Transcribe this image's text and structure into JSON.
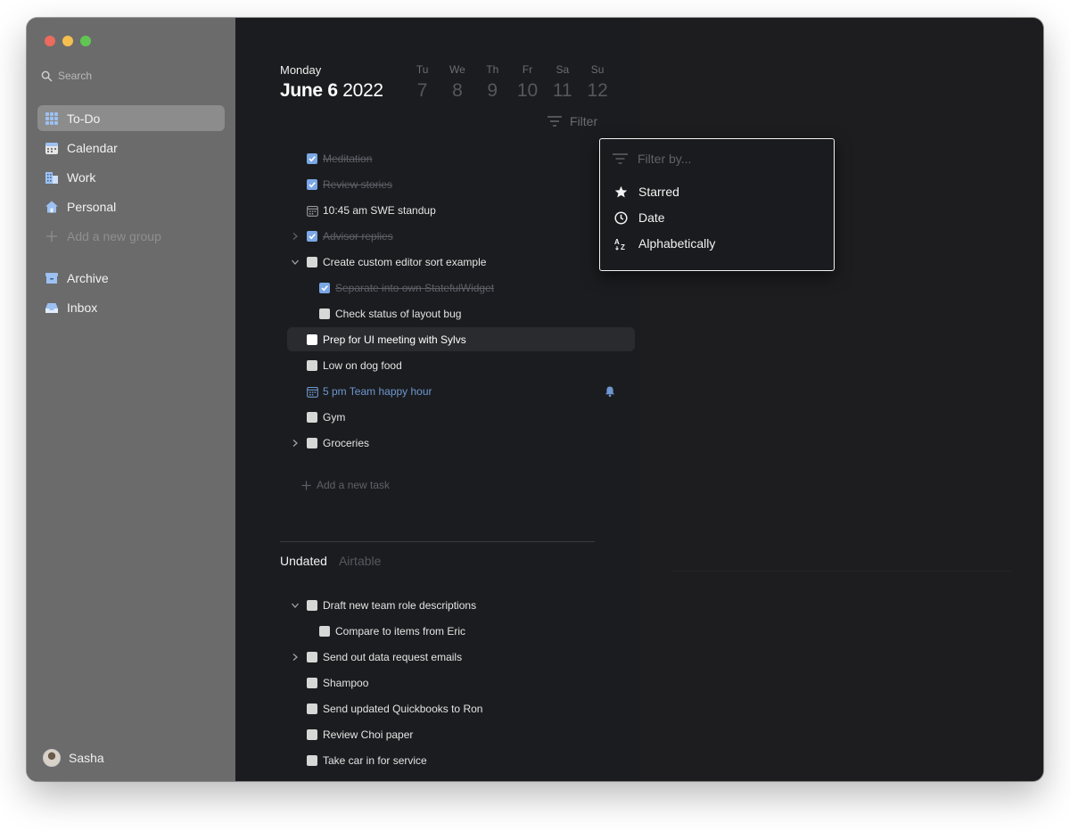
{
  "sidebar": {
    "search_placeholder": "Search",
    "items": [
      {
        "label": "To-Do",
        "icon": "grid-icon"
      },
      {
        "label": "Calendar",
        "icon": "calendar-icon"
      },
      {
        "label": "Work",
        "icon": "building-icon"
      },
      {
        "label": "Personal",
        "icon": "home-icon"
      }
    ],
    "add_group_label": "Add a new group",
    "secondary_items": [
      {
        "label": "Archive",
        "icon": "archive-icon"
      },
      {
        "label": "Inbox",
        "icon": "inbox-icon"
      }
    ],
    "user_name": "Sasha"
  },
  "header": {
    "day_name": "Monday",
    "date_bold": "June 6",
    "year": "2022",
    "week": [
      {
        "label": "Tu",
        "num": "7"
      },
      {
        "label": "We",
        "num": "8"
      },
      {
        "label": "Th",
        "num": "9"
      },
      {
        "label": "Fr",
        "num": "10"
      },
      {
        "label": "Sa",
        "num": "11"
      },
      {
        "label": "Su",
        "num": "12"
      }
    ],
    "filter_label": "Filter"
  },
  "tasks": [
    {
      "label": "Meditation",
      "state": "done",
      "trailing_icon": "repeat-icon"
    },
    {
      "label": "Review stories",
      "state": "done"
    },
    {
      "label": "10:45 am SWE standup",
      "state": "event"
    },
    {
      "label": "Advisor replies",
      "state": "done",
      "collapsed": true
    },
    {
      "label": "Create custom editor sort example",
      "state": "open",
      "expanded": true
    },
    {
      "label": "Separate into own StatefulWidget",
      "state": "done",
      "child": true
    },
    {
      "label": "Check status of layout bug",
      "state": "open",
      "child": true
    },
    {
      "label": "Prep for UI meeting with Sylvs",
      "state": "open",
      "highlighted": true
    },
    {
      "label": "Low on dog food",
      "state": "open"
    },
    {
      "label": "5 pm Team happy hour",
      "state": "event-link",
      "trailing_icon": "bell-icon"
    },
    {
      "label": "Gym",
      "state": "open"
    },
    {
      "label": "Groceries",
      "state": "open",
      "collapsed": true
    }
  ],
  "add_task_label": "Add a new task",
  "section_tabs": {
    "active": "Undated",
    "inactive": "Airtable"
  },
  "undated_tasks": [
    {
      "label": "Draft new team role descriptions",
      "expanded": true
    },
    {
      "label": "Compare to items from Eric",
      "child": true
    },
    {
      "label": "Send out data request emails",
      "collapsed": true
    },
    {
      "label": "Shampoo"
    },
    {
      "label": "Send updated Quickbooks to Ron"
    },
    {
      "label": "Review Choi paper"
    },
    {
      "label": "Take car in for service"
    }
  ],
  "filter_menu": {
    "placeholder": "Filter by...",
    "options": [
      {
        "label": "Starred",
        "icon": "star-icon"
      },
      {
        "label": "Date",
        "icon": "clock-icon"
      },
      {
        "label": "Alphabetically",
        "icon": "az-sort-icon"
      }
    ]
  },
  "colors": {
    "sidebar_bg": "#6b6b6b",
    "main_bg": "#1b1c1f",
    "accent_blue": "#7aa7e6",
    "link_blue": "#6c97cf"
  }
}
